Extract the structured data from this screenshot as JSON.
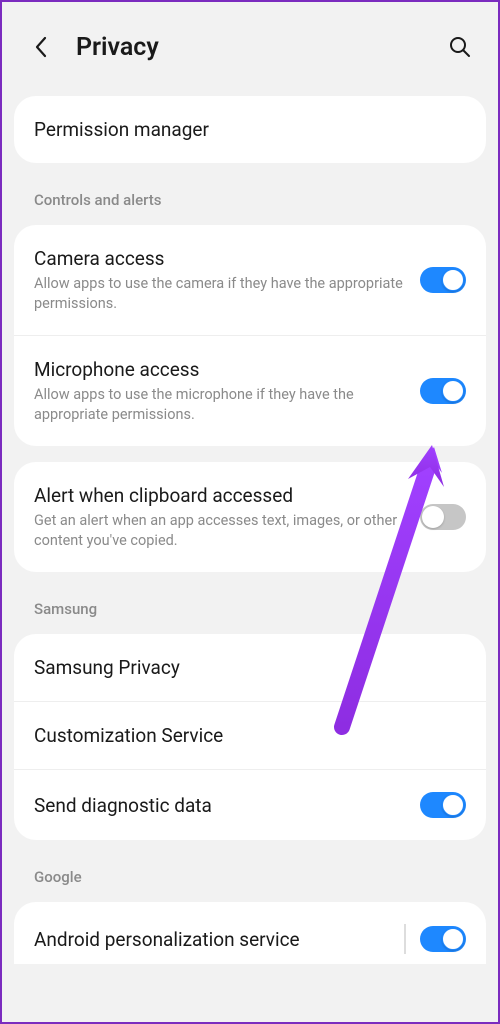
{
  "header": {
    "title": "Privacy"
  },
  "sections": {
    "permission_manager": "Permission manager",
    "controls_label": "Controls and alerts",
    "camera": {
      "title": "Camera access",
      "sub": "Allow apps to use the camera if they have the appropriate permissions."
    },
    "microphone": {
      "title": "Microphone access",
      "sub": "Allow apps to use the microphone if they have the appropriate permissions."
    },
    "clipboard": {
      "title": "Alert when clipboard accessed",
      "sub": "Get an alert when an app accesses text, images, or other content you've copied."
    },
    "samsung_label": "Samsung",
    "samsung_privacy": "Samsung Privacy",
    "customization": "Customization Service",
    "diagnostic": "Send diagnostic data",
    "google_label": "Google",
    "personalization": "Android personalization service"
  }
}
